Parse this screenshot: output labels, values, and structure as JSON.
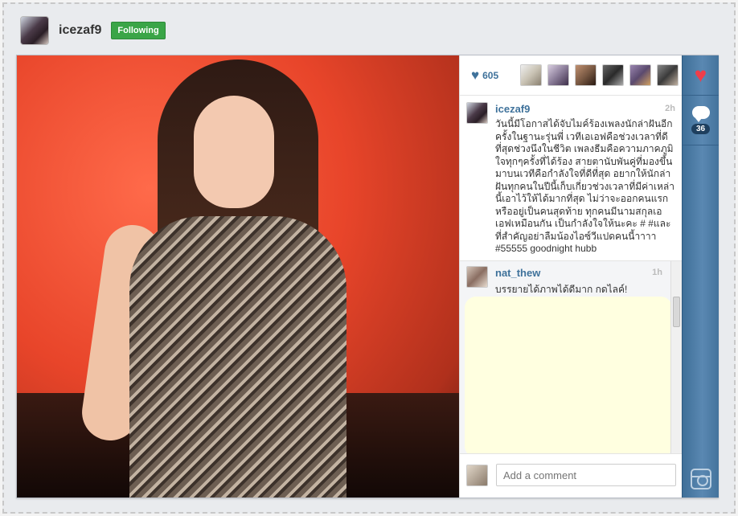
{
  "header": {
    "username": "icezaf9",
    "follow_label": "Following",
    "follow_color": "#3aa547"
  },
  "post": {
    "likes_count": "605",
    "likers": [
      {
        "icon": "liker-avatar",
        "color": "#c9c3b4"
      },
      {
        "icon": "liker-avatar",
        "color": "#8a7c98"
      },
      {
        "icon": "liker-avatar",
        "color": "#7a5a44"
      },
      {
        "icon": "liker-avatar",
        "color": "#2a2a2a"
      },
      {
        "icon": "liker-avatar",
        "color": "#5b4a6e"
      },
      {
        "icon": "liker-avatar",
        "color": "#3a3a3a"
      }
    ],
    "caption": {
      "username": "icezaf9",
      "time": "2h",
      "text": "วันนี้มีโอกาสได้จับไมค์ร้องเพลงนักล่าฝันอีกครั้งในฐานะรุ่นพี่ เวทีเอเอฟคือช่วงเวลาที่ดีที่สุดช่วงนึงในชีวิต เพลงธีมคือความภาคภูมิใจทุกๆครั้งที่ได้ร้อง สายตานับพันคู่ที่มองขึ้นมาบนเวทีคือกำลังใจที่ดีที่สุด อยากให้นักล่าฝันทุกคนในปีนี้เก็บเกี่ยวช่วงเวลาที่มีค่าเหล่านี้เอาไว้ให้ได้มากที่สุด ไม่ว่าจะออกคนแรกหรืออยู่เป็นคนสุดท้าย ทุกคนมีนามสกุลเอเอฟเหมือนกัน เป็นกำลังใจให้นะคะ # #และที่สำคัญอย่าลืมน้องไอซ์วีแปดคนนี้าาาา #55555 goodnight hubb"
    },
    "comments": [
      {
        "username": "nat_thew",
        "time": "1h",
        "text": "บรรยายได้ภาพได้ดีมาก กดไลค์!"
      }
    ],
    "comment_placeholder": "Add a comment",
    "comments_count": "36"
  },
  "colors": {
    "brand_blue": "#3f729b",
    "like_red": "#ef3e4a",
    "ad_bg": "#ffffe0"
  },
  "icons": {
    "like_count_icon": "heart-icon",
    "action_like": "heart-icon",
    "action_comment": "comment-bubble-icon",
    "action_instagram": "instagram-icon"
  }
}
